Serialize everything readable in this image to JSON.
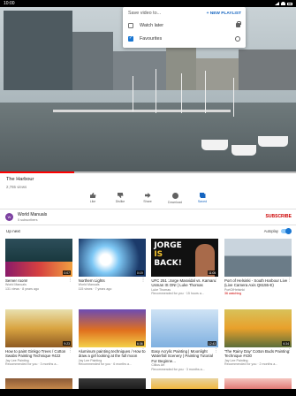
{
  "status_bar": {
    "time": "10:00"
  },
  "save_popup": {
    "heading": "Save video to...",
    "new_playlist": "+ NEW PLAYLIST",
    "items": [
      {
        "label": "Watch later",
        "checked": false,
        "privacy_icon": "lock-icon"
      },
      {
        "label": "Favourites",
        "checked": true,
        "privacy_icon": "globe-icon"
      }
    ]
  },
  "player": {
    "progress_fraction": 0.25
  },
  "video": {
    "title": "The Harbour",
    "views": "2,765 views"
  },
  "actions": [
    {
      "label": "Like",
      "icon": "thumb-up-icon"
    },
    {
      "label": "Dislike",
      "icon": "thumb-down-icon"
    },
    {
      "label": "Share",
      "icon": "share-icon"
    },
    {
      "label": "Download",
      "icon": "download-icon"
    },
    {
      "label": "Saved",
      "icon": "saved-icon"
    }
  ],
  "channel": {
    "name": "World Manuals",
    "subscribers": "5 subscribers",
    "subscribe": "SUBSCRIBE",
    "avatar_letter": "W"
  },
  "up_next": {
    "label": "Up next",
    "autoplay": "Autoplay",
    "autoplay_on": true
  },
  "thumb3_text": {
    "line1": "JORGE",
    "line2": "IS",
    "line3": "BACK!"
  },
  "rows": [
    [
      {
        "title": "Server room!",
        "meta1": "World Manuals",
        "meta2": "131 views · 8 years ago",
        "duration": "0:07"
      },
      {
        "title": "Northern Lights",
        "meta1": "World Manuals",
        "meta2": "115 views · 7 years ago",
        "duration": "0:19"
      },
      {
        "title": "UFC 251 :Jorge Masvidal vs. Kamaru Usman IS ON! | Luke Thomas",
        "meta1": "Luke Thomas",
        "meta2": "Recommended for you · 15 hours a...",
        "duration": "11:05"
      },
      {
        "title": "Port of Helsinki - South Harbour Live (Live Camera Axis Q6155-E)",
        "meta1": "PortOfHelsinki",
        "meta2": "36 watching",
        "duration": ""
      }
    ],
    [
      {
        "title": "How to paint Ginkgo Trees / Cotton Swabs Painting Technique #422",
        "meta1": "Jay Lee Painting",
        "meta2": "Recommended for you · 3 months a...",
        "duration": "9:23"
      },
      {
        "title": "Aluminum painting techniques / How to draw a girl looking at the full moon",
        "meta1": "Jay Lee Painting",
        "meta2": "Recommended for you · 6 months a...",
        "duration": "6:36"
      },
      {
        "title": "Easy Acrylic Painting | Moonlight Waterfall Scenery | Painting Tutorial For Beginne...",
        "meta1": "Cillius Art",
        "meta2": "Recommended for you · 3 months a...",
        "duration": "12:43"
      },
      {
        "title": "'The Rainy Day' Cotton Buds Painting Technique #430",
        "meta1": "Jay Lee Painting",
        "meta2": "Recommended for you · 2 months a...",
        "duration": "6:34"
      }
    ]
  ]
}
